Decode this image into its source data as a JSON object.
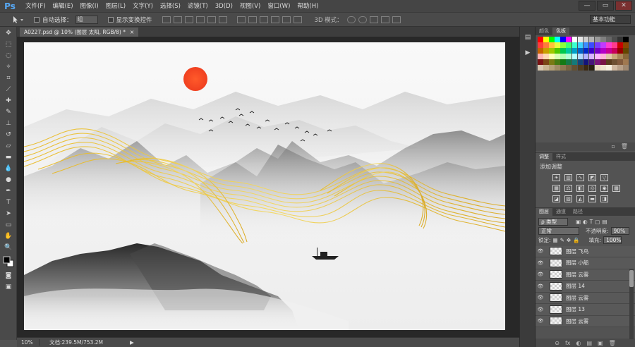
{
  "app": {
    "logo": "Ps"
  },
  "menu": [
    "文件(F)",
    "编辑(E)",
    "图像(I)",
    "图层(L)",
    "文字(Y)",
    "选择(S)",
    "滤镜(T)",
    "3D(D)",
    "视图(V)",
    "窗口(W)",
    "帮助(H)"
  ],
  "window_controls": [
    "—",
    "▭",
    "✕"
  ],
  "options": {
    "auto_select_label": "自动选择：",
    "auto_select_value": "组",
    "show_transform_label": "显示变换控件",
    "mode3d_label": "3D 模式：",
    "workspace": "基本功能"
  },
  "document": {
    "tab_title": "A0227.psd @ 10% (图层 太阳, RGB/8) *",
    "close": "×"
  },
  "status": {
    "zoom": "10%",
    "doc_info": "文档:239.5M/753.2M",
    "arrow": "▶"
  },
  "panels": {
    "color_tabs": [
      "颜色",
      "色板"
    ],
    "adjust_tabs": [
      "调整",
      "样式"
    ],
    "adjust_title": "添加调整",
    "layers_tabs": [
      "图层",
      "通道",
      "路径"
    ],
    "filter_kind": "ρ 类型",
    "blend_mode": "正常",
    "opacity_label": "不透明度:",
    "opacity_value": "90%",
    "lock_label": "锁定:",
    "fill_label": "填充:",
    "fill_value": "100%",
    "footer_icons": [
      "⊝",
      "fx",
      "◐",
      "▤",
      "▣",
      "🗑"
    ]
  },
  "layers": [
    {
      "name": "图层 飞鸟"
    },
    {
      "name": "图层 小船"
    },
    {
      "name": "图层 云雾"
    },
    {
      "name": "图层 14"
    },
    {
      "name": "图层 云雾"
    },
    {
      "name": "图层 13"
    },
    {
      "name": "图层 云雾"
    }
  ],
  "swatch_colors": [
    "#ff0000",
    "#ffff00",
    "#00ff00",
    "#00ffff",
    "#0000ff",
    "#ff00ff",
    "#ffffff",
    "#e6e6e6",
    "#cccccc",
    "#b3b3b3",
    "#999999",
    "#808080",
    "#666666",
    "#4d4d4d",
    "#333333",
    "#000000",
    "#ff3b3b",
    "#ff7a3b",
    "#ffc23b",
    "#e8ff3b",
    "#8cff3b",
    "#3bff6e",
    "#3bffd0",
    "#3bd0ff",
    "#3b8cff",
    "#3b4cff",
    "#7a3bff",
    "#c23bff",
    "#ff3bd0",
    "#ff3b8c",
    "#c80000",
    "#8c4600",
    "#c86400",
    "#c8a000",
    "#a0c800",
    "#50c800",
    "#00c850",
    "#00c8a0",
    "#00a0c8",
    "#0064c8",
    "#0028c8",
    "#3c00c8",
    "#7800c8",
    "#b400c8",
    "#c80096",
    "#c8005a",
    "#960000",
    "#644600",
    "#ffb3b3",
    "#ffd9b3",
    "#ffffb3",
    "#d9ffb3",
    "#b3ffb3",
    "#b3ffd9",
    "#b3ffff",
    "#b3d9ff",
    "#b3b3ff",
    "#d9b3ff",
    "#ffb3ff",
    "#ffb3d9",
    "#e0c8a8",
    "#c8a878",
    "#a88858",
    "#886838",
    "#7a1414",
    "#7a4614",
    "#7a7a14",
    "#467a14",
    "#147a14",
    "#147a46",
    "#147a7a",
    "#14467a",
    "#14147a",
    "#46147a",
    "#7a147a",
    "#7a1446",
    "#5a3c1e",
    "#6e5032",
    "#825a3c",
    "#a07850",
    "#d8c8b0",
    "#c8b490",
    "#b4a078",
    "#a08c64",
    "#8c7850",
    "#786440",
    "#645030",
    "#503c20",
    "#3c2810",
    "#282010",
    "#e8d8c0",
    "#f0e4d0",
    "#f8f0e0",
    "#d0b8a0",
    "#b8a088",
    "#a08870"
  ]
}
